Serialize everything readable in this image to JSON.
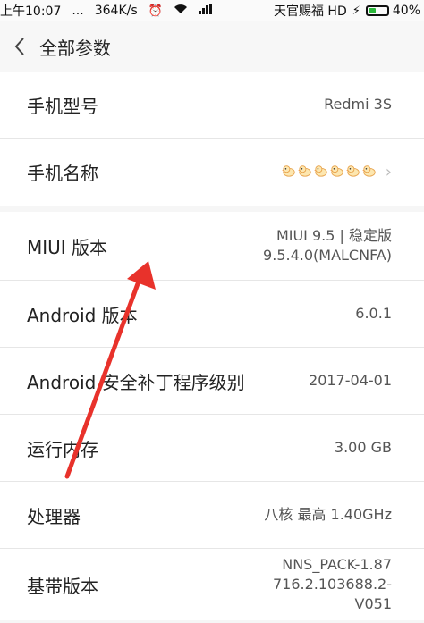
{
  "status_bar": {
    "time": "上午10:07",
    "dots": "...",
    "speed": "364K/s",
    "carrier": "天官赐福 HD",
    "battery": "40%",
    "battery_level": 0.4
  },
  "header": {
    "title": "全部参数"
  },
  "device_card": {
    "rows": [
      {
        "label": "手机型号",
        "value": "Redmi 3S"
      },
      {
        "label": "手机名称",
        "value": ""
      }
    ]
  },
  "specs_card": {
    "rows": [
      {
        "label": "MIUI 版本",
        "value_line1": "MIUI 9.5 | 稳定版",
        "value_line2": "9.5.4.0(MALCNFA)"
      },
      {
        "label": "Android 版本",
        "value": "6.0.1"
      },
      {
        "label": "Android 安全补丁程序级别",
        "value": "2017-04-01"
      },
      {
        "label": "运行内存",
        "value": "3.00 GB"
      },
      {
        "label": "处理器",
        "value": "八核 最高 1.40GHz"
      },
      {
        "label": "基带版本",
        "value_line1": "NNS_PACK-1.87",
        "value_line2": "716.2.103688.2-",
        "value_line3": "V051"
      }
    ]
  },
  "colors": {
    "arrow": "#e8322b",
    "battery": "#2bb83b"
  }
}
